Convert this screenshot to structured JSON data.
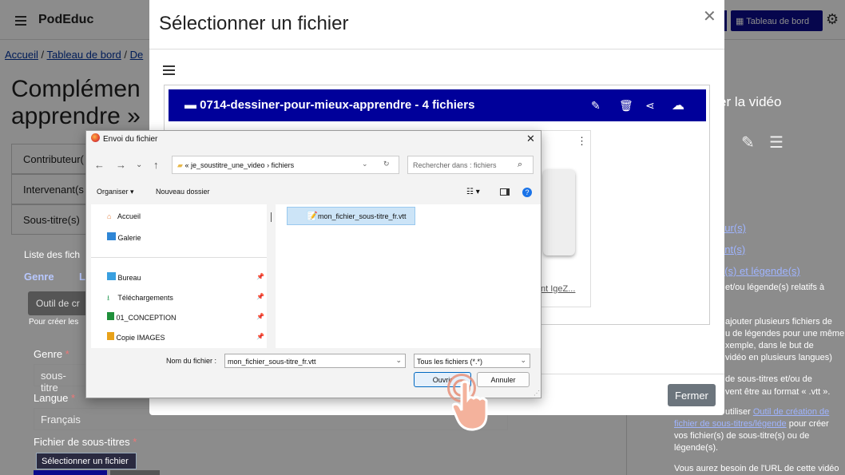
{
  "app": {
    "brand": "PodEduc",
    "dashboard_label": "Tableau de bord"
  },
  "breadcrumb": [
    "Accueil",
    "Tableau de bord",
    "De"
  ],
  "page": {
    "title_lines": [
      "Complémen",
      "apprendre »"
    ],
    "accordion": [
      "Contributeur(",
      "Intervenant(s",
      "Sous-titre(s)"
    ],
    "list_label": "Liste des fich",
    "genre_col": "Genre",
    "genre_col2": "L",
    "outil_btn": "Outil de cr",
    "pour_creer": "Pour créer les",
    "genre_label": "Genre",
    "genre_value": "sous-titre",
    "langue_label": "Langue",
    "langue_value": "Français",
    "fichier_label": "Fichier de sous-titres",
    "select_file_btn": "Sélectionner un fichier"
  },
  "right_panel": {
    "title": "er la vidéo",
    "links": [
      "eur(s)",
      "ant(s)",
      "e(s) et légende(s)"
    ],
    "p1": "et/ou légende(s) relatifs à",
    "p2_lines": [
      "ajouter plusieurs fichiers de",
      "u de légendes pour une même",
      "xemple, dans le but de",
      "vidéo en plusieurs langues)"
    ],
    "p3_lines": [
      "de sous-titres et/ou de",
      "vent être au format « .vtt »."
    ],
    "p4_prefix": "utiliser",
    "p4_link1": "Outil de création de",
    "p4_link2": "fichier de sous-titres/légende",
    "p4_rest1": "pour créer",
    "p4_rest2": "vos fichier(s) de sous-titre(s) ou de",
    "p4_rest3": "légende(s).",
    "p5": "Vous aurez besoin de l'URL de cette vidéo"
  },
  "modal": {
    "title": "Sélectionner un fichier",
    "folder": "0714-dessiner-pour-mieux-apprendre - 4 fichiers",
    "card_link": "nt IgeZ...",
    "close_button": "Fermer"
  },
  "dialog": {
    "title": "Envoi du fichier",
    "path": [
      "«",
      "je_soustitre_une_video",
      "›",
      "fichiers"
    ],
    "search_placeholder": "Rechercher dans : fichiers",
    "organise": "Organiser ▾",
    "new_folder": "Nouveau dossier",
    "sidebar": [
      {
        "label": "Accueil",
        "icon": "home-icon",
        "color": "#e07b39"
      },
      {
        "label": "Galerie",
        "icon": "gallery-icon",
        "color": "#2f86d6"
      },
      {
        "label": "Bureau",
        "icon": "desktop-icon",
        "color": "#3aa0e0"
      },
      {
        "label": "Téléchargements",
        "icon": "download-icon",
        "color": "#2e9e5a"
      },
      {
        "label": "01_CONCEPTION",
        "icon": "folder-icon",
        "color": "#1f8f3a"
      },
      {
        "label": "Copie IMAGES",
        "icon": "folder-icon",
        "color": "#e8a21a"
      }
    ],
    "file": "mon_fichier_sous-titre_fr.vtt",
    "filename_label": "Nom du fichier :",
    "filename_value": "mon_fichier_sous-titre_fr.vtt",
    "filter_value": "Tous les fichiers (*.*)",
    "open_btn": "Ouvrir",
    "cancel_btn": "Annuler"
  }
}
